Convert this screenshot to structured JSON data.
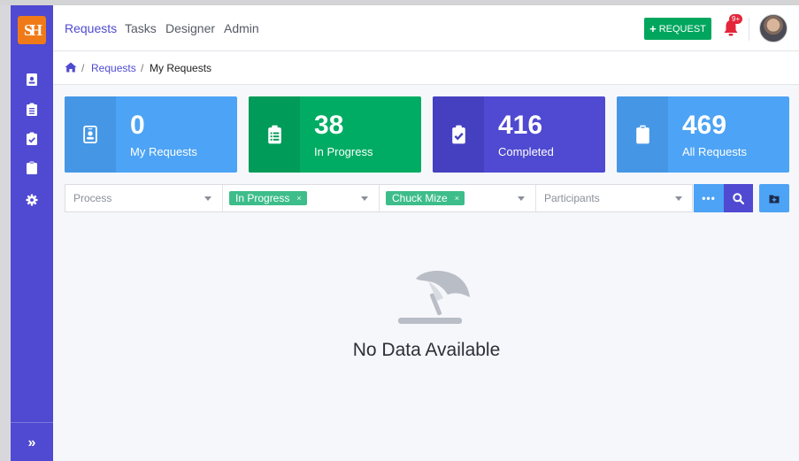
{
  "app": {
    "logo_text": "SH"
  },
  "nav": {
    "links": [
      {
        "label": "Requests",
        "active": true
      },
      {
        "label": "Tasks",
        "active": false
      },
      {
        "label": "Designer",
        "active": false
      },
      {
        "label": "Admin",
        "active": false
      }
    ],
    "request_button": "REQUEST",
    "notification_badge": "9+"
  },
  "sidebar": {
    "items": [
      {
        "icon": "id-badge-icon"
      },
      {
        "icon": "clipboard-list-icon"
      },
      {
        "icon": "clipboard-check-icon"
      },
      {
        "icon": "clipboard-icon"
      },
      {
        "icon": "gear-icon"
      }
    ],
    "expand_icon": "chevron-double-right-icon",
    "expand_glyph": "»"
  },
  "breadcrumb": {
    "separator": "/",
    "items": [
      "Requests",
      "My Requests"
    ]
  },
  "cards": [
    {
      "count": "0",
      "label": "My Requests",
      "color": "#4da3f5",
      "icon_bg": "#4597e6",
      "icon": "id-badge-icon"
    },
    {
      "count": "38",
      "label": "In Progress",
      "color": "#00ac63",
      "icon_bg": "#009b59",
      "icon": "clipboard-list-icon"
    },
    {
      "count": "416",
      "label": "Completed",
      "color": "#4f4ad1",
      "icon_bg": "#4540bf",
      "icon": "clipboard-check-icon"
    },
    {
      "count": "469",
      "label": "All Requests",
      "color": "#4da3f5",
      "icon_bg": "#4597e6",
      "icon": "clipboard-icon"
    }
  ],
  "filters": {
    "process": {
      "placeholder": "Process"
    },
    "status": {
      "tag": "In Progress",
      "remove": "×"
    },
    "requester": {
      "tag": "Chuck Mize",
      "remove": "×"
    },
    "participants": {
      "placeholder": "Participants"
    },
    "more_label": "•••"
  },
  "empty_state": {
    "message": "No Data Available",
    "icon": "beach-umbrella-icon"
  },
  "colors": {
    "primary": "#4f4ad1",
    "success": "#00a65e",
    "info": "#4da3f5",
    "danger": "#e4263a"
  }
}
